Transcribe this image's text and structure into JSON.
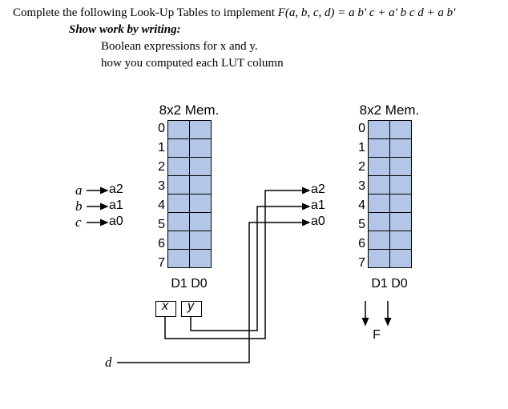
{
  "prompt": {
    "line1_prefix": "Complete the following Look-Up Tables to implement ",
    "line1_func": "F(a, b, c, d) = a b' c + a' b c d + a b'",
    "line2": "Show work by writing:",
    "line3": "Boolean expressions for x and y.",
    "line4": "how you computed each LUT column"
  },
  "mem1": {
    "title": "8x2 Mem.",
    "rows": [
      "0",
      "1",
      "2",
      "3",
      "4",
      "5",
      "6",
      "7"
    ],
    "addrs": [
      "a2",
      "a1",
      "a0"
    ],
    "outs": [
      "D1",
      "D0"
    ],
    "xy": [
      "x",
      "y"
    ]
  },
  "mem2": {
    "title": "8x2 Mem.",
    "rows": [
      "0",
      "1",
      "2",
      "3",
      "4",
      "5",
      "6",
      "7"
    ],
    "addrs": [
      "a2",
      "a1",
      "a0"
    ],
    "outs": [
      "D1",
      "D0"
    ],
    "final": "F"
  },
  "inputs": {
    "a": "a",
    "b": "b",
    "c": "c",
    "d": "d"
  }
}
